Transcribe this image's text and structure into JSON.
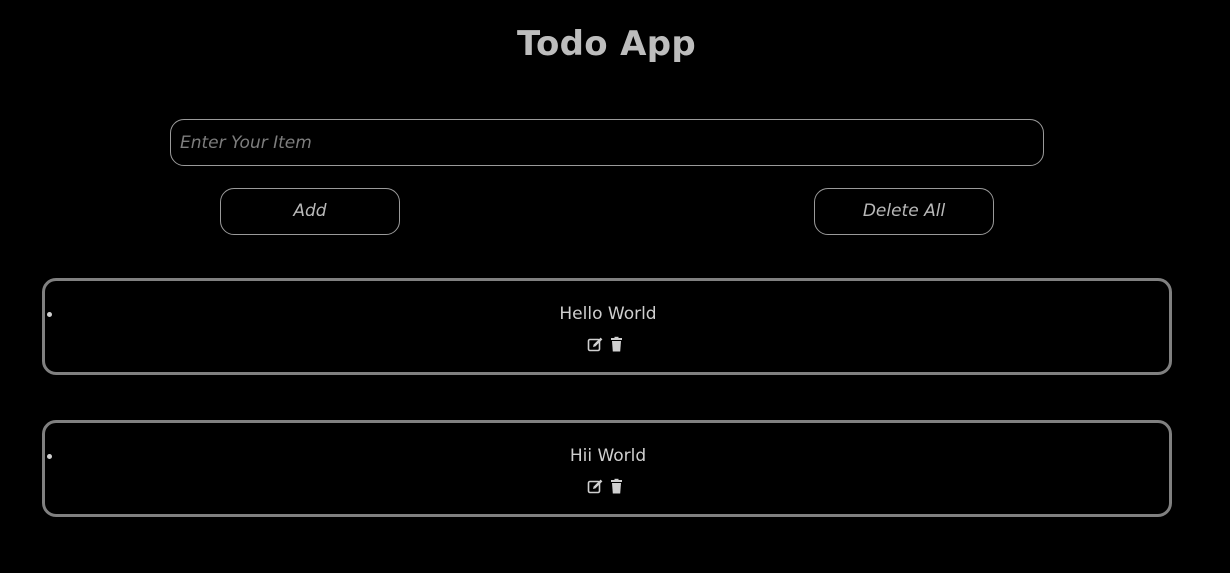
{
  "app": {
    "title": "Todo App"
  },
  "input": {
    "value": "",
    "placeholder": "Enter Your Item"
  },
  "buttons": {
    "add_label": "Add",
    "delete_all_label": "Delete All"
  },
  "todos": [
    {
      "text": "Hello World",
      "edit_icon": "edit-icon",
      "delete_icon": "trash-icon"
    },
    {
      "text": "Hii World",
      "edit_icon": "edit-icon",
      "delete_icon": "trash-icon"
    }
  ],
  "colors": {
    "background": "#000000",
    "text": "#cfcfcf",
    "border": "#808080",
    "placeholder": "#7d7d7d"
  }
}
